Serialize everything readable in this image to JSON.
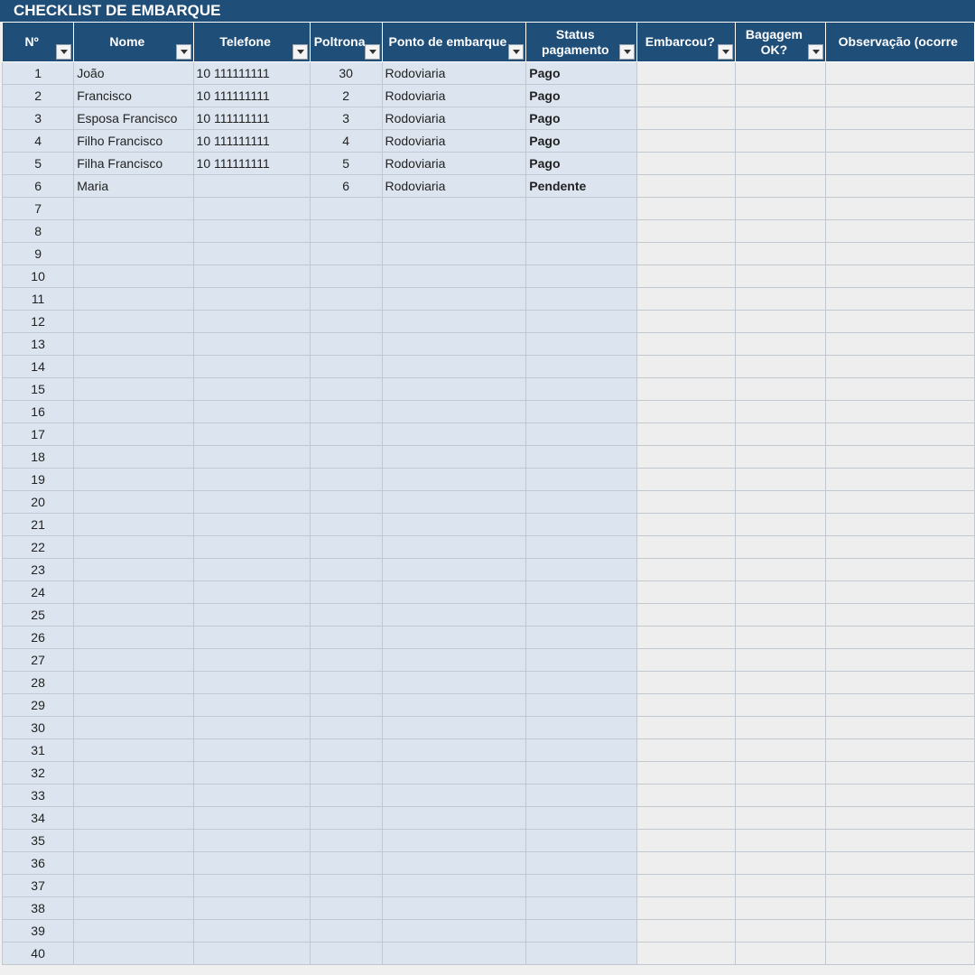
{
  "sheet_title": "CHECKLIST DE EMBARQUE",
  "columns": [
    {
      "label": "Nº"
    },
    {
      "label": "Nome"
    },
    {
      "label": "Telefone"
    },
    {
      "label": "Poltrona"
    },
    {
      "label": "Ponto de embarque"
    },
    {
      "label": "Status pagamento"
    },
    {
      "label": "Embarcou?"
    },
    {
      "label": "Bagagem OK?"
    },
    {
      "label": "Observação (ocorre"
    }
  ],
  "rows": [
    {
      "n": "1",
      "nome": "João",
      "telefone": "10 111111111",
      "poltrona": "30",
      "ponto": "Rodoviaria",
      "status": "Pago",
      "embarcou": "",
      "bagagem": "",
      "obs": ""
    },
    {
      "n": "2",
      "nome": "Francisco",
      "telefone": "10 111111111",
      "poltrona": "2",
      "ponto": "Rodoviaria",
      "status": "Pago",
      "embarcou": "",
      "bagagem": "",
      "obs": ""
    },
    {
      "n": "3",
      "nome": "Esposa Francisco",
      "telefone": "10 111111111",
      "poltrona": "3",
      "ponto": "Rodoviaria",
      "status": "Pago",
      "embarcou": "",
      "bagagem": "",
      "obs": ""
    },
    {
      "n": "4",
      "nome": "Filho  Francisco",
      "telefone": "10 111111111",
      "poltrona": "4",
      "ponto": "Rodoviaria",
      "status": "Pago",
      "embarcou": "",
      "bagagem": "",
      "obs": ""
    },
    {
      "n": "5",
      "nome": "Filha Francisco",
      "telefone": "10 111111111",
      "poltrona": "5",
      "ponto": "Rodoviaria",
      "status": "Pago",
      "embarcou": "",
      "bagagem": "",
      "obs": ""
    },
    {
      "n": "6",
      "nome": "Maria",
      "telefone": "",
      "poltrona": "6",
      "ponto": "Rodoviaria",
      "status": "Pendente",
      "embarcou": "",
      "bagagem": "",
      "obs": ""
    },
    {
      "n": "7"
    },
    {
      "n": "8"
    },
    {
      "n": "9"
    },
    {
      "n": "10"
    },
    {
      "n": "11"
    },
    {
      "n": "12"
    },
    {
      "n": "13"
    },
    {
      "n": "14"
    },
    {
      "n": "15"
    },
    {
      "n": "16"
    },
    {
      "n": "17"
    },
    {
      "n": "18"
    },
    {
      "n": "19"
    },
    {
      "n": "20"
    },
    {
      "n": "21"
    },
    {
      "n": "22"
    },
    {
      "n": "23"
    },
    {
      "n": "24"
    },
    {
      "n": "25"
    },
    {
      "n": "26"
    },
    {
      "n": "27"
    },
    {
      "n": "28"
    },
    {
      "n": "29"
    },
    {
      "n": "30"
    },
    {
      "n": "31"
    },
    {
      "n": "32"
    },
    {
      "n": "33"
    },
    {
      "n": "34"
    },
    {
      "n": "35"
    },
    {
      "n": "36"
    },
    {
      "n": "37"
    },
    {
      "n": "38"
    },
    {
      "n": "39"
    },
    {
      "n": "40"
    }
  ],
  "colors": {
    "header_bg": "#1f4e79",
    "data_fill": "#dce5ef",
    "check_fill": "#eeeeee",
    "status_pago": "#008000",
    "status_pendente": "#ffffff"
  },
  "icons": {
    "filter": "filter-dropdown-icon"
  }
}
